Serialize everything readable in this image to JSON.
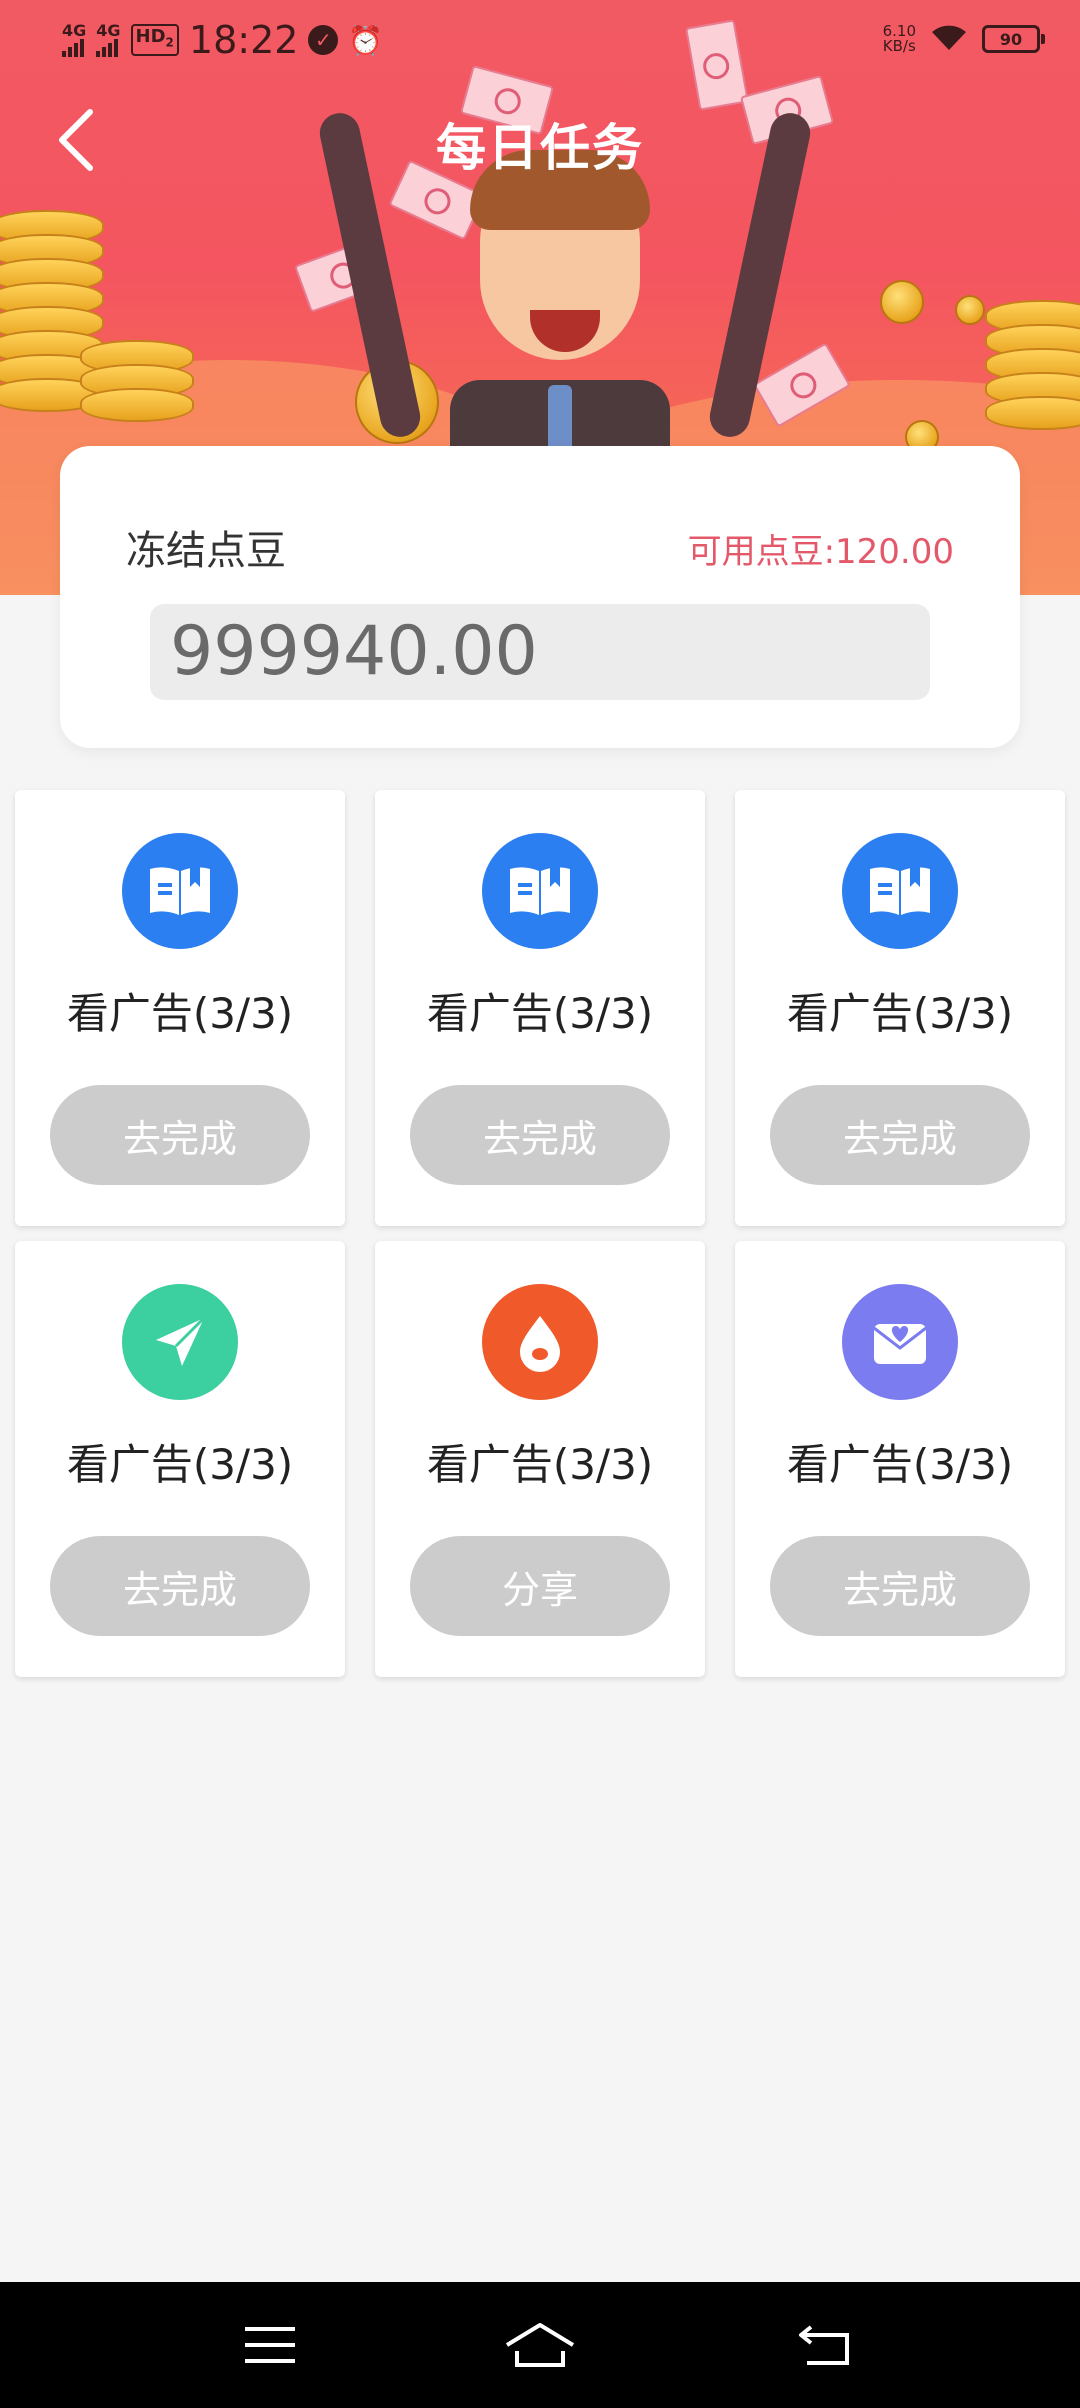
{
  "status_bar": {
    "network1": "4G",
    "network2": "4G",
    "hd": "HD",
    "hd_sub": "2",
    "time": "18:22",
    "speed_value": "6.10",
    "speed_unit": "KB/s",
    "battery": "90"
  },
  "header": {
    "title": "每日任务",
    "back_icon": "chevron-left-icon"
  },
  "balance": {
    "frozen_label": "冻结点豆",
    "available_label": "可用点豆:120.00",
    "frozen_value": "999940.00"
  },
  "tasks": [
    {
      "label": "看广告(3/3)",
      "button": "去完成",
      "icon": "book-icon",
      "icon_color": "#2b7ff0"
    },
    {
      "label": "看广告(3/3)",
      "button": "去完成",
      "icon": "book-icon",
      "icon_color": "#2b7ff0"
    },
    {
      "label": "看广告(3/3)",
      "button": "去完成",
      "icon": "book-icon",
      "icon_color": "#2b7ff0"
    },
    {
      "label": "看广告(3/3)",
      "button": "去完成",
      "icon": "paper-plane-icon",
      "icon_color": "#3ccf9f"
    },
    {
      "label": "看广告(3/3)",
      "button": "分享",
      "icon": "flame-drop-icon",
      "icon_color": "#f05a2a"
    },
    {
      "label": "看广告(3/3)",
      "button": "去完成",
      "icon": "heart-envelope-icon",
      "icon_color": "#7b7cf0"
    }
  ],
  "colors": {
    "accent": "#e4596a",
    "button_disabled": "#cccccc",
    "banner_top": "#f25a63"
  },
  "navbar": {
    "menu_icon": "menu-icon",
    "home_icon": "home-icon",
    "back_icon": "back-arrow-icon"
  }
}
